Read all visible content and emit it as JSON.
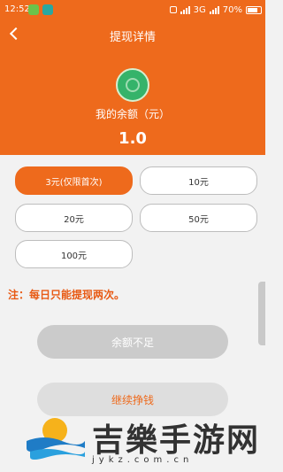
{
  "status_bar": {
    "time": "12:52",
    "network": "3G",
    "battery": "70%"
  },
  "header": {
    "title": "提现详情",
    "balance_label": "我的余额（元）",
    "balance_value": "1.0",
    "color": "#ee6a1c"
  },
  "options": [
    {
      "label": "3元(仅限首次)",
      "selected": true
    },
    {
      "label": "10元",
      "selected": false
    },
    {
      "label": "20元",
      "selected": false
    },
    {
      "label": "50元",
      "selected": false
    },
    {
      "label": "100元",
      "selected": false
    }
  ],
  "note": "注：每日只能提现两次。",
  "buttons": {
    "insufficient": "余额不足",
    "continue": "继续挣钱"
  },
  "watermark": {
    "text": "吉樂手游网",
    "url": "jykz.com.cn"
  },
  "icons": [
    "back-arrow-icon",
    "coin-icon"
  ]
}
